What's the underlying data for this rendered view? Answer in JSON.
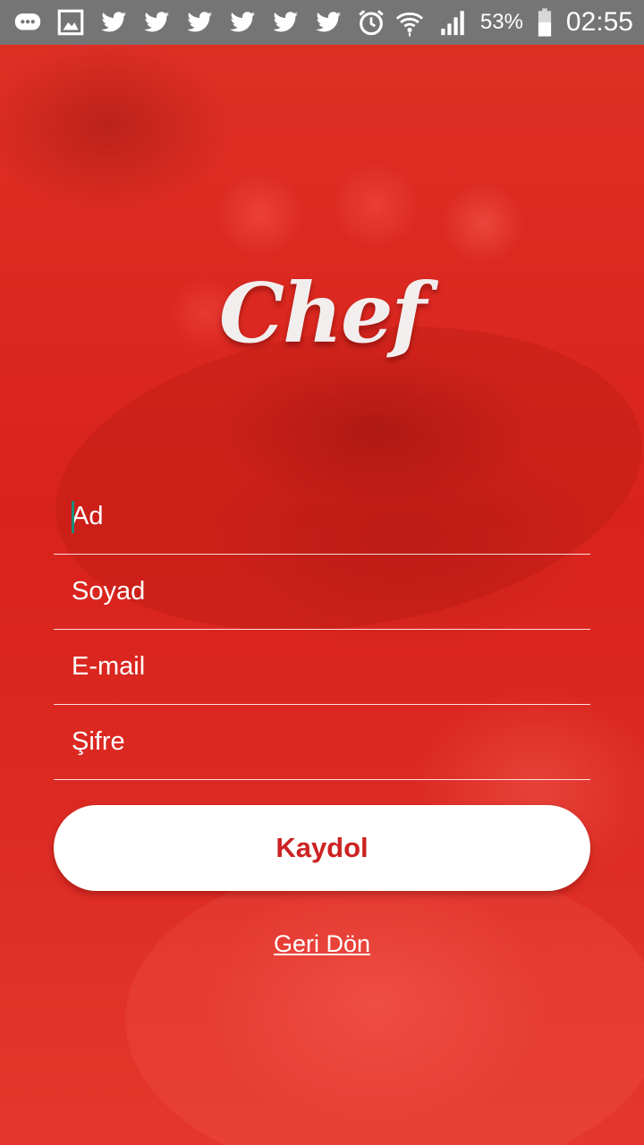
{
  "status_bar": {
    "battery_percent": "53%",
    "time": "02:55",
    "left_icons": [
      "chat-icon",
      "image-icon",
      "twitter-icon",
      "twitter-icon",
      "twitter-icon",
      "twitter-icon",
      "twitter-icon",
      "twitter-icon",
      "alarm-icon"
    ],
    "right_icons": [
      "wifi-icon",
      "signal-icon",
      "battery-icon"
    ]
  },
  "logo": {
    "text": "Chef"
  },
  "form": {
    "first_name": {
      "placeholder": "Ad",
      "value": ""
    },
    "last_name": {
      "placeholder": "Soyad",
      "value": ""
    },
    "email": {
      "placeholder": "E-mail",
      "value": ""
    },
    "password": {
      "placeholder": "Şifre",
      "value": ""
    }
  },
  "submit_label": "Kaydol",
  "back_label": "Geri Dön",
  "colors": {
    "background": "#d8221c",
    "status_bar": "#757575",
    "button_bg": "#ffffff",
    "button_text": "#cc2222",
    "cursor": "#1a8c7a"
  }
}
